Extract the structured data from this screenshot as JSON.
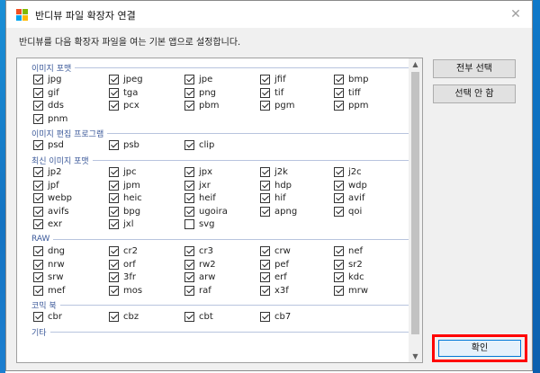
{
  "window": {
    "title": "반디뷰 파일 확장자 연결",
    "close_glyph": "✕"
  },
  "description": "반디뷰를 다음 확장자 파일을 여는 기본 앱으로 설정합니다.",
  "buttons": {
    "select_all": "전부 선택",
    "deselect_all": "선택 안 함",
    "ok": "확인"
  },
  "groups": [
    {
      "title": "이미지 포맷",
      "items": [
        {
          "label": "jpg",
          "checked": true
        },
        {
          "label": "jpeg",
          "checked": true
        },
        {
          "label": "jpe",
          "checked": true
        },
        {
          "label": "jfif",
          "checked": true
        },
        {
          "label": "bmp",
          "checked": true
        },
        {
          "label": "gif",
          "checked": true
        },
        {
          "label": "tga",
          "checked": true
        },
        {
          "label": "png",
          "checked": true
        },
        {
          "label": "tif",
          "checked": true
        },
        {
          "label": "tiff",
          "checked": true
        },
        {
          "label": "dds",
          "checked": true
        },
        {
          "label": "pcx",
          "checked": true
        },
        {
          "label": "pbm",
          "checked": true
        },
        {
          "label": "pgm",
          "checked": true
        },
        {
          "label": "ppm",
          "checked": true
        },
        {
          "label": "pnm",
          "checked": true
        }
      ]
    },
    {
      "title": "이미지 편집 프로그램",
      "items": [
        {
          "label": "psd",
          "checked": true
        },
        {
          "label": "psb",
          "checked": true
        },
        {
          "label": "clip",
          "checked": true
        }
      ]
    },
    {
      "title": "최신 이미지 포맷",
      "items": [
        {
          "label": "jp2",
          "checked": true
        },
        {
          "label": "jpc",
          "checked": true
        },
        {
          "label": "jpx",
          "checked": true
        },
        {
          "label": "j2k",
          "checked": true
        },
        {
          "label": "j2c",
          "checked": true
        },
        {
          "label": "jpf",
          "checked": true
        },
        {
          "label": "jpm",
          "checked": true
        },
        {
          "label": "jxr",
          "checked": true
        },
        {
          "label": "hdp",
          "checked": true
        },
        {
          "label": "wdp",
          "checked": true
        },
        {
          "label": "webp",
          "checked": true
        },
        {
          "label": "heic",
          "checked": true
        },
        {
          "label": "heif",
          "checked": true
        },
        {
          "label": "hif",
          "checked": true
        },
        {
          "label": "avif",
          "checked": true
        },
        {
          "label": "avifs",
          "checked": true
        },
        {
          "label": "bpg",
          "checked": true
        },
        {
          "label": "ugoira",
          "checked": true
        },
        {
          "label": "apng",
          "checked": true
        },
        {
          "label": "qoi",
          "checked": true
        },
        {
          "label": "exr",
          "checked": true
        },
        {
          "label": "jxl",
          "checked": true
        },
        {
          "label": "svg",
          "checked": false
        }
      ]
    },
    {
      "title": "RAW",
      "items": [
        {
          "label": "dng",
          "checked": true
        },
        {
          "label": "cr2",
          "checked": true
        },
        {
          "label": "cr3",
          "checked": true
        },
        {
          "label": "crw",
          "checked": true
        },
        {
          "label": "nef",
          "checked": true
        },
        {
          "label": "nrw",
          "checked": true
        },
        {
          "label": "orf",
          "checked": true
        },
        {
          "label": "rw2",
          "checked": true
        },
        {
          "label": "pef",
          "checked": true
        },
        {
          "label": "sr2",
          "checked": true
        },
        {
          "label": "srw",
          "checked": true
        },
        {
          "label": "3fr",
          "checked": true
        },
        {
          "label": "arw",
          "checked": true
        },
        {
          "label": "erf",
          "checked": true
        },
        {
          "label": "kdc",
          "checked": true
        },
        {
          "label": "mef",
          "checked": true
        },
        {
          "label": "mos",
          "checked": true
        },
        {
          "label": "raf",
          "checked": true
        },
        {
          "label": "x3f",
          "checked": true
        },
        {
          "label": "mrw",
          "checked": true
        }
      ]
    },
    {
      "title": "코믹 북",
      "items": [
        {
          "label": "cbr",
          "checked": true
        },
        {
          "label": "cbz",
          "checked": true
        },
        {
          "label": "cbt",
          "checked": true
        },
        {
          "label": "cb7",
          "checked": true
        }
      ]
    },
    {
      "title": "기타",
      "items": []
    }
  ]
}
